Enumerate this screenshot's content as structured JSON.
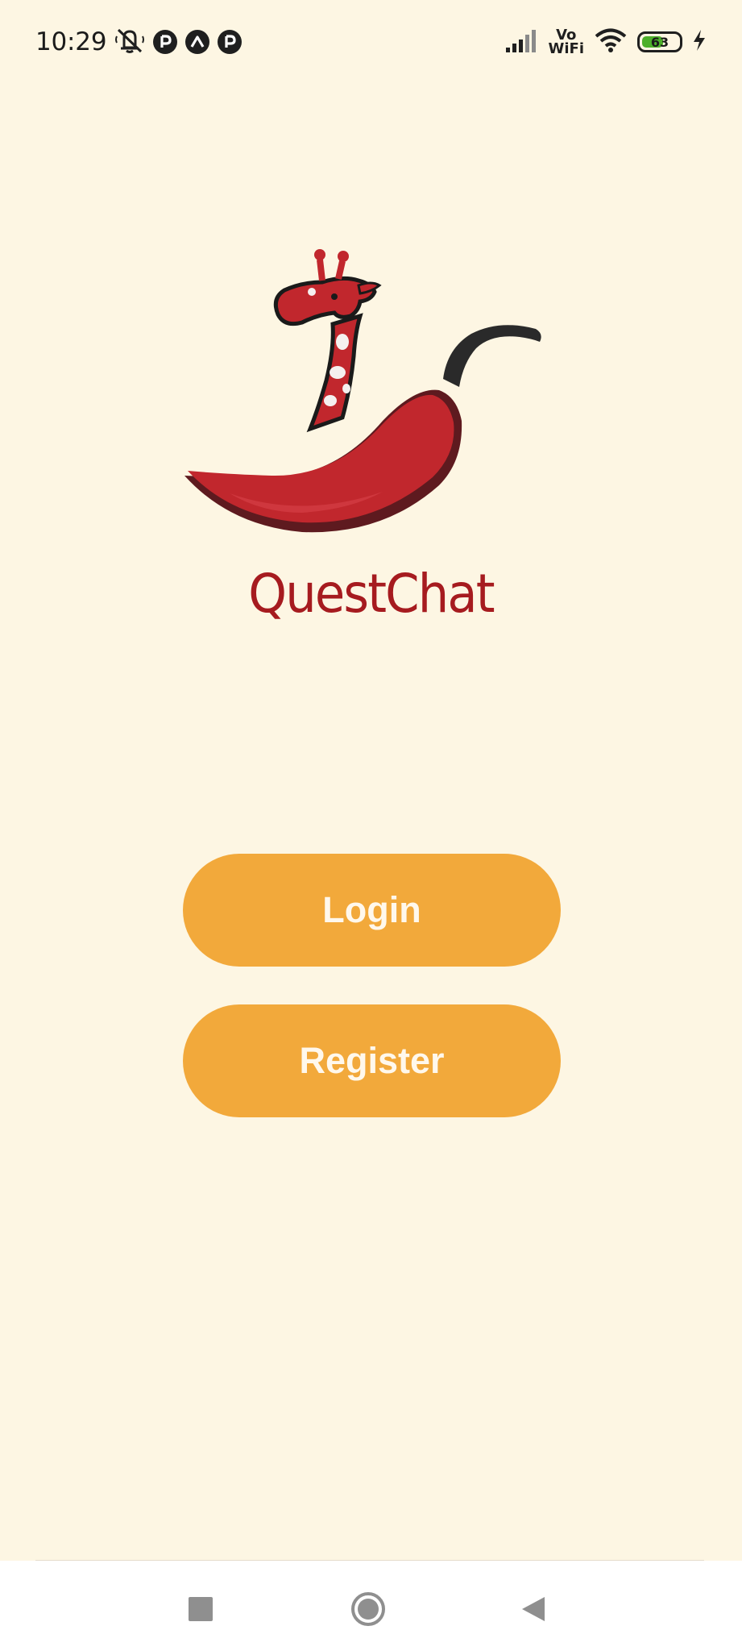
{
  "status_bar": {
    "time": "10:29",
    "network_label_top": "Vo",
    "network_label_bottom": "WiFi",
    "battery_level": "63",
    "battery_fraction": 0.63,
    "icons": [
      "mute-icon",
      "notification-p-icon",
      "notification-a-icon",
      "notification-p-icon",
      "signal-icon",
      "wifi-icon",
      "battery-icon",
      "charging-icon"
    ]
  },
  "branding": {
    "app_name": "QuestChat",
    "logo_icon": "giraffe-chili-logo"
  },
  "actions": {
    "login_label": "Login",
    "register_label": "Register"
  },
  "nav_bar": {
    "icons": [
      "recent-apps-icon",
      "home-icon",
      "back-icon"
    ]
  },
  "colors": {
    "background": "#fdf6e3",
    "button": "#f2a93b",
    "button_text": "#fff8ec",
    "brand_red": "#a61b1f"
  }
}
